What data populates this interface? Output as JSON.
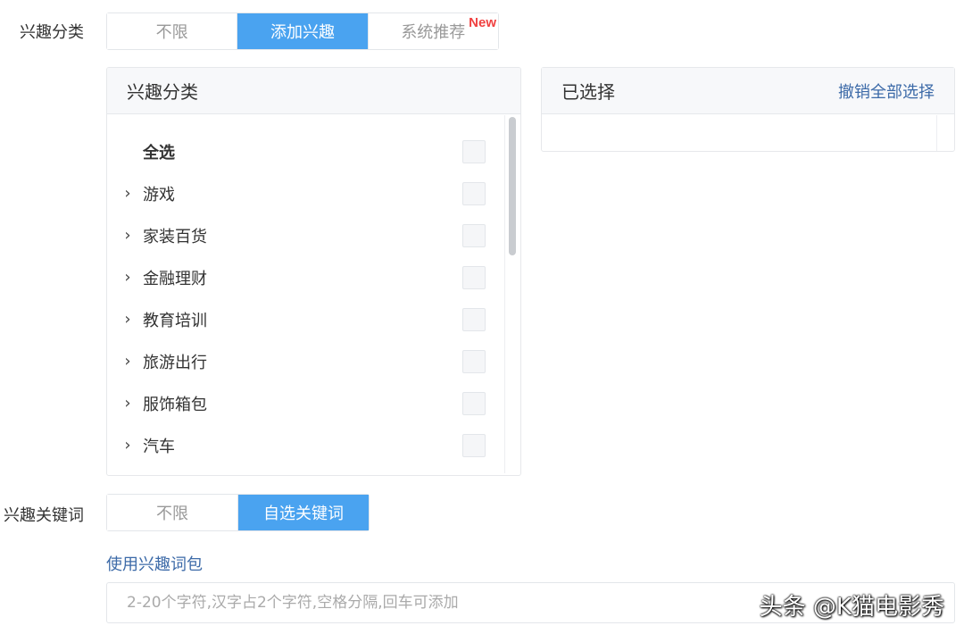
{
  "interest_category": {
    "label": "兴趣分类",
    "options": [
      {
        "label": "不限",
        "active": false
      },
      {
        "label": "添加兴趣",
        "active": true
      },
      {
        "label": "系统推荐",
        "active": false,
        "badge": "New"
      }
    ]
  },
  "category_panel": {
    "title": "兴趣分类",
    "items": [
      {
        "label": "全选",
        "expandable": false,
        "bold": true
      },
      {
        "label": "游戏",
        "expandable": true
      },
      {
        "label": "家装百货",
        "expandable": true
      },
      {
        "label": "金融理财",
        "expandable": true
      },
      {
        "label": "教育培训",
        "expandable": true
      },
      {
        "label": "旅游出行",
        "expandable": true
      },
      {
        "label": "服饰箱包",
        "expandable": true
      },
      {
        "label": "汽车",
        "expandable": true
      }
    ]
  },
  "selected_panel": {
    "title": "已选择",
    "clear_all_label": "撤销全部选择"
  },
  "interest_keywords": {
    "label": "兴趣关键词",
    "options": [
      {
        "label": "不限",
        "active": false
      },
      {
        "label": "自选关键词",
        "active": true
      }
    ],
    "package_link": "使用兴趣词包",
    "input_placeholder": "2-20个字符,汉字占2个字符,空格分隔,回车可添加"
  },
  "watermark": "头条 @K猫电影秀",
  "colors": {
    "accent": "#4aa3f0",
    "link": "#3c6aa8",
    "badge": "#f04141"
  },
  "icons": {
    "expand": "chevron-right-icon"
  }
}
